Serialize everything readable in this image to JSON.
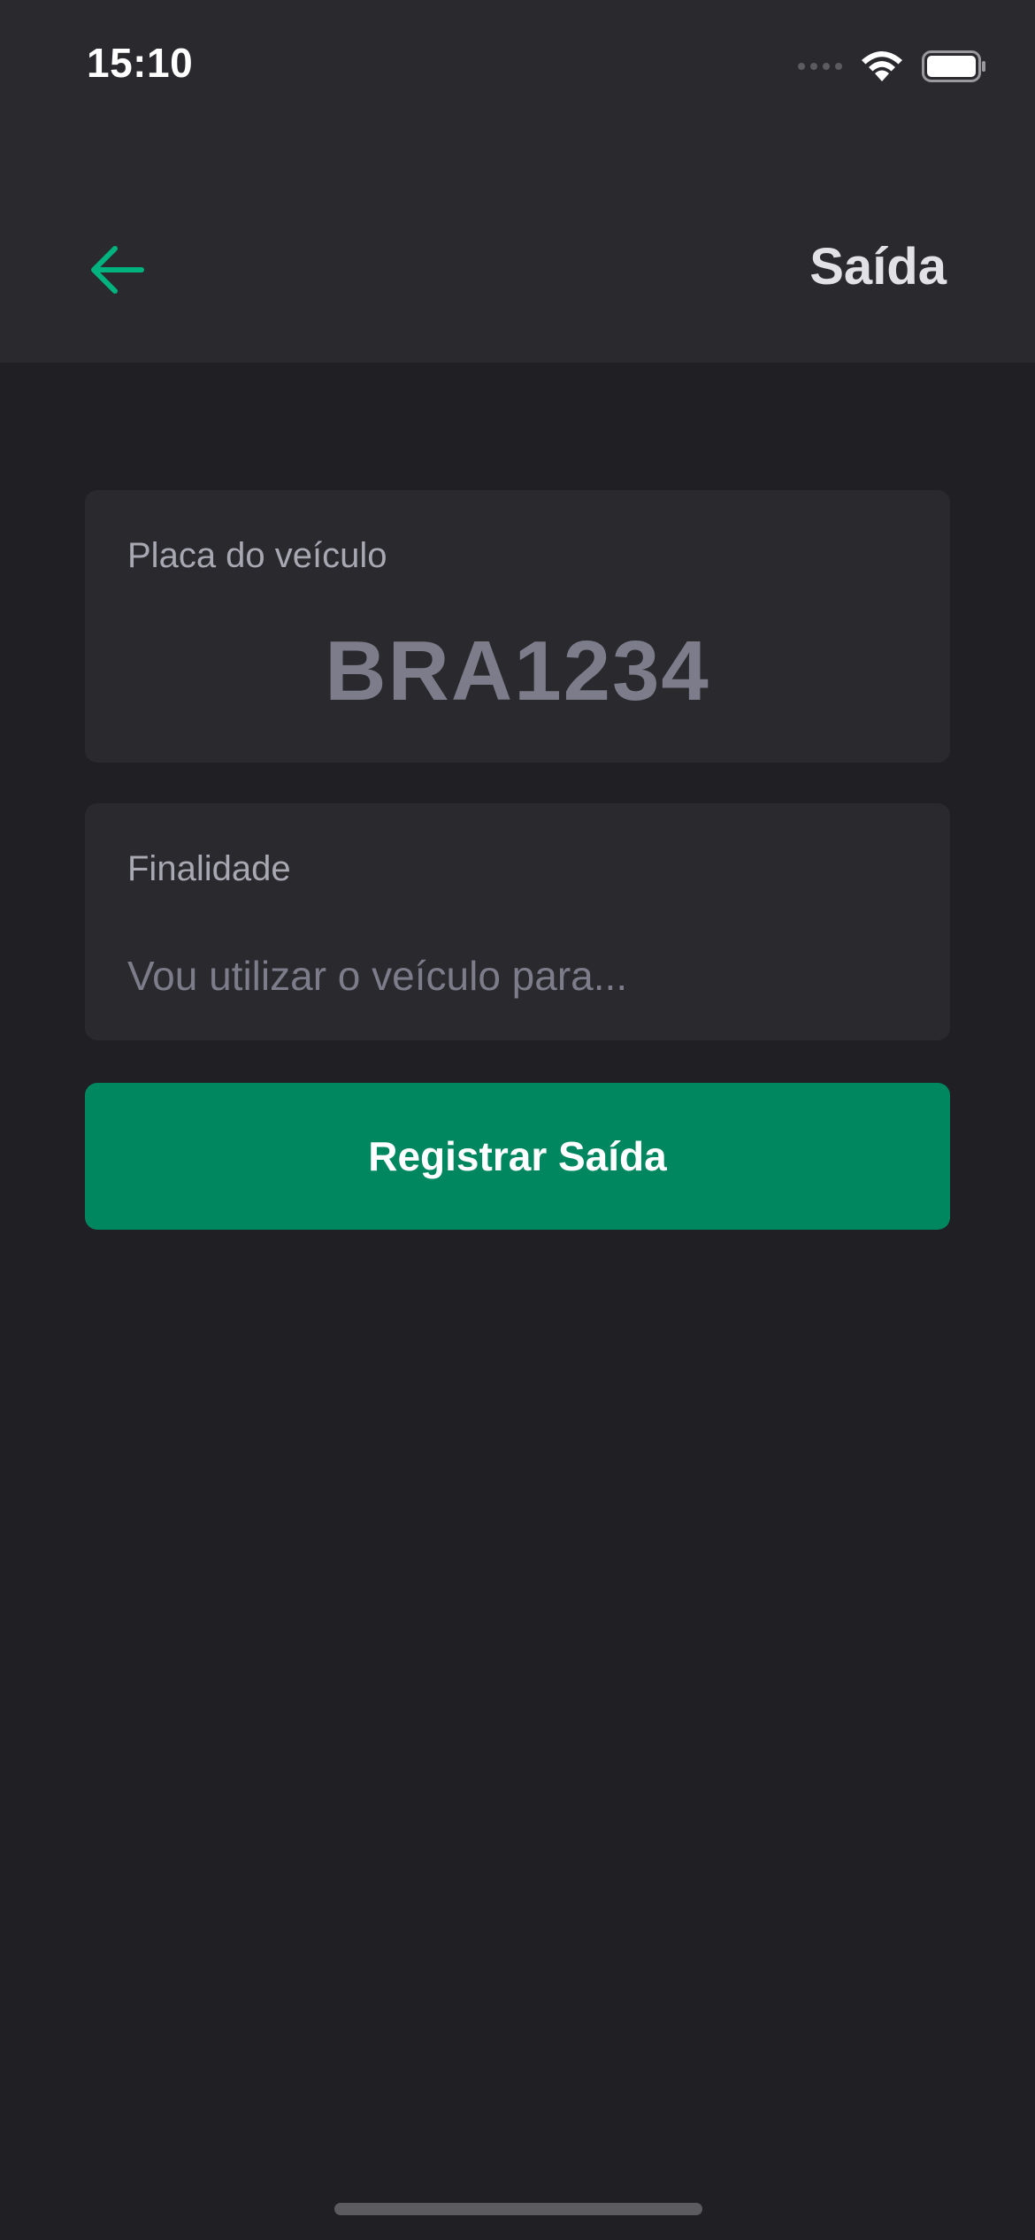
{
  "status_bar": {
    "time": "15:10"
  },
  "header": {
    "title": "Saída",
    "back_icon": "arrow-left-icon"
  },
  "form": {
    "plate": {
      "label": "Placa do veículo",
      "value": "BRA1234"
    },
    "purpose": {
      "label": "Finalidade",
      "placeholder": "Vou utilizar o veículo para...",
      "value": ""
    },
    "submit_label": "Registrar Saída"
  },
  "colors": {
    "accent": "#00875f",
    "back_arrow": "#00b37e",
    "background": "#202024",
    "surface": "#29292e"
  }
}
